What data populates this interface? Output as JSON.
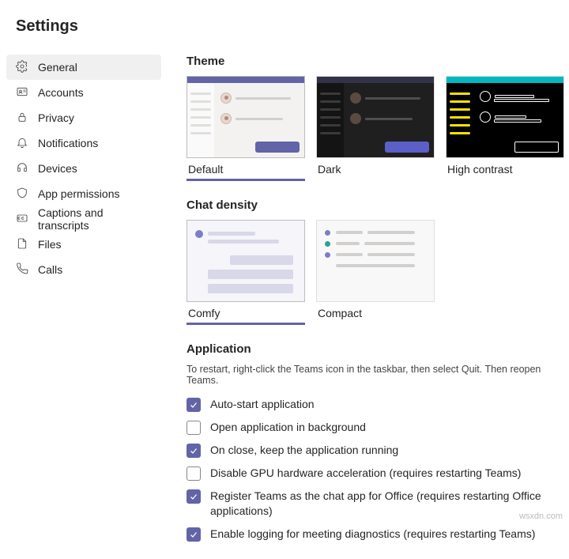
{
  "title": "Settings",
  "sidebar": {
    "items": [
      {
        "label": "General"
      },
      {
        "label": "Accounts"
      },
      {
        "label": "Privacy"
      },
      {
        "label": "Notifications"
      },
      {
        "label": "Devices"
      },
      {
        "label": "App permissions"
      },
      {
        "label": "Captions and transcripts"
      },
      {
        "label": "Files"
      },
      {
        "label": "Calls"
      }
    ]
  },
  "theme": {
    "title": "Theme",
    "options": [
      {
        "label": "Default"
      },
      {
        "label": "Dark"
      },
      {
        "label": "High contrast"
      }
    ],
    "selected": "Default"
  },
  "density": {
    "title": "Chat density",
    "options": [
      {
        "label": "Comfy"
      },
      {
        "label": "Compact"
      }
    ],
    "selected": "Comfy"
  },
  "application": {
    "title": "Application",
    "subtitle": "To restart, right-click the Teams icon in the taskbar, then select Quit. Then reopen Teams.",
    "settings": [
      {
        "label": "Auto-start application",
        "checked": true
      },
      {
        "label": "Open application in background",
        "checked": false
      },
      {
        "label": "On close, keep the application running",
        "checked": true
      },
      {
        "label": "Disable GPU hardware acceleration (requires restarting Teams)",
        "checked": false
      },
      {
        "label": "Register Teams as the chat app for Office (requires restarting Office applications)",
        "checked": true
      },
      {
        "label": "Enable logging for meeting diagnostics (requires restarting Teams)",
        "checked": true
      }
    ]
  },
  "watermark": "wsxdn.com"
}
